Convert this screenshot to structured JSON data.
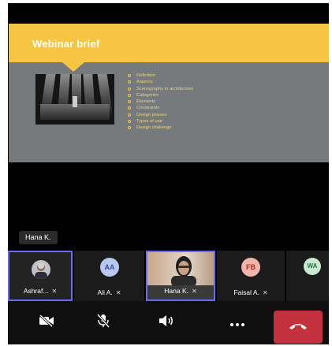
{
  "slide": {
    "title": "Webinar brief",
    "bullets": [
      "Definition",
      "Aspects",
      "Scenography in architecture",
      "Categories",
      "Elements",
      "Constraints",
      "Design phases",
      "Types of use",
      "Design challenge"
    ]
  },
  "presenter_label": "Hana K.",
  "participants": [
    {
      "name": "Ashraf...",
      "kind": "photo",
      "active": true
    },
    {
      "name": "Ali A.",
      "initials": "AA",
      "kind": "initials",
      "color": "#b9c8f0",
      "text_color": "#3a4fa3",
      "active": false
    },
    {
      "name": "Hana K.",
      "kind": "photo",
      "active": true
    },
    {
      "name": "Faisal A.",
      "initials": "FB",
      "kind": "initials",
      "color": "#f2b4a8",
      "text_color": "#a0352a",
      "active": false
    },
    {
      "initials": "WA",
      "kind": "initials",
      "color": "#c9e8d2",
      "text_color": "#2d6e45",
      "active": false
    }
  ],
  "controls": {
    "camera_icon": "camera-off-icon",
    "mic_icon": "mic-off-icon",
    "speaker_icon": "speaker-icon",
    "more_icon": "more-icon",
    "hangup_icon": "hang-up-icon",
    "hangup_color": "#c3313f"
  }
}
